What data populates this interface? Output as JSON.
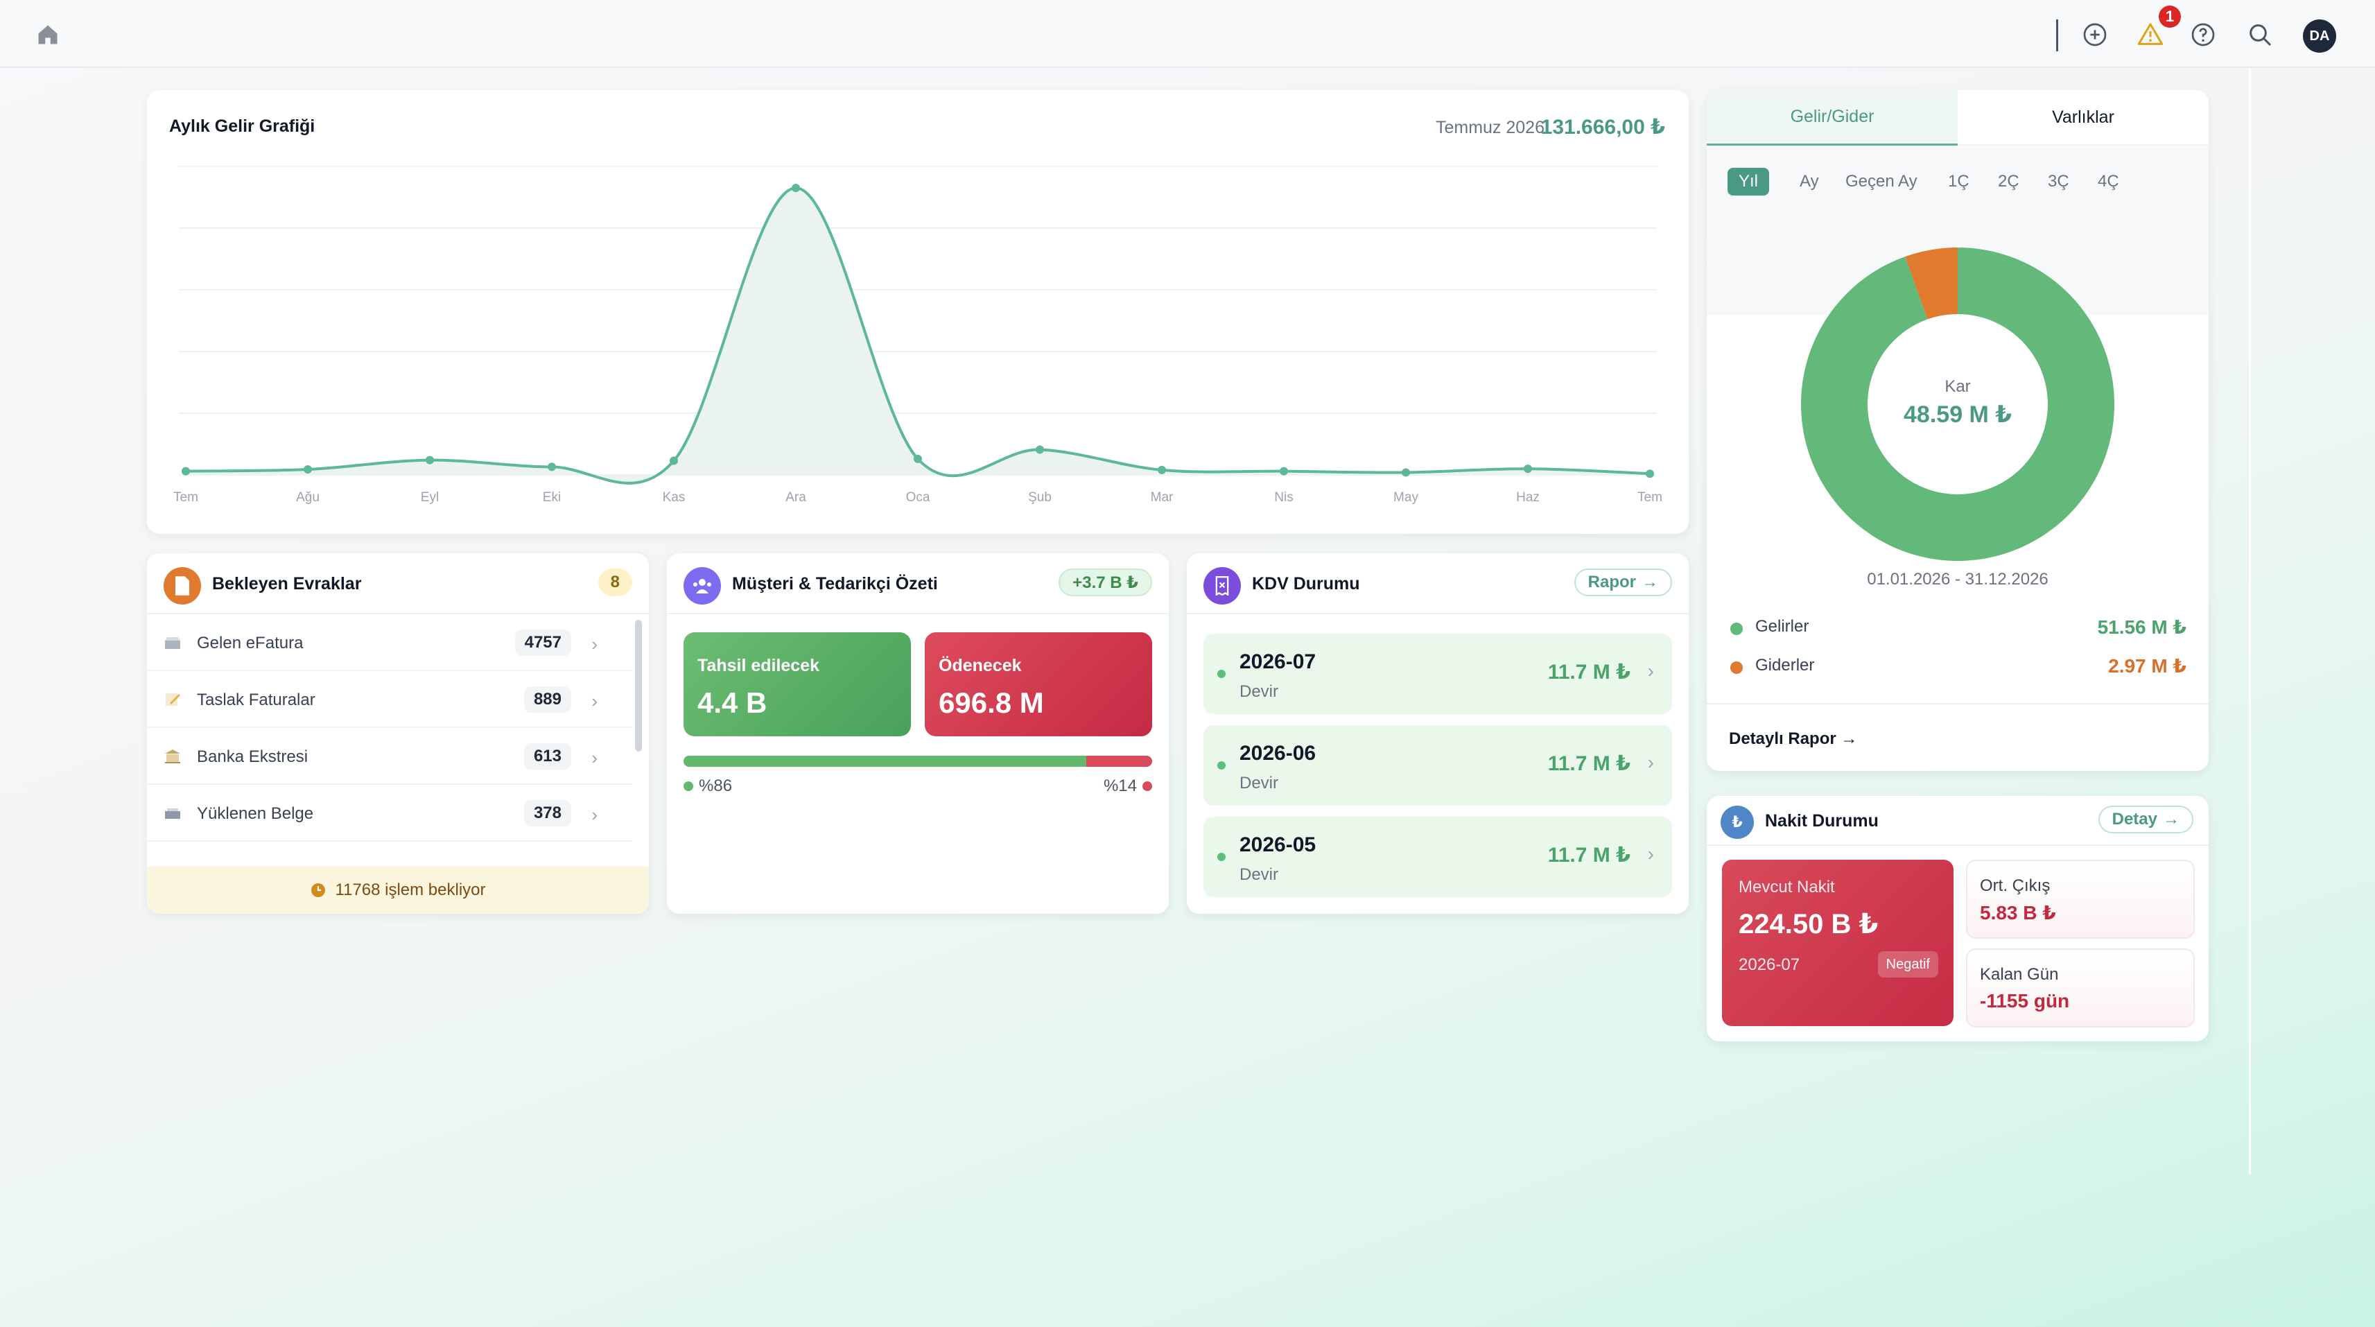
{
  "header": {
    "alert_count": "1",
    "user_initials": "DA"
  },
  "revenue_chart": {
    "title": "Aylık Gelir Grafiği",
    "period": "Temmuz 2026",
    "total": "131.666,00 ₺"
  },
  "chart_data": {
    "type": "area",
    "categories": [
      "Tem",
      "Ağu",
      "Eyl",
      "Eki",
      "Kas",
      "Ara",
      "Oca",
      "Şub",
      "Mar",
      "Nis",
      "May",
      "Haz",
      "Tem"
    ],
    "series": [
      {
        "values": [
          0.6,
          0.9,
          2.4,
          1.3,
          2.3,
          46.5,
          2.6,
          4.1,
          0.8,
          0.6,
          0.4,
          1.0,
          0.2
        ]
      }
    ],
    "ylim": [
      0,
      50
    ],
    "grid": true,
    "colors": {
      "line": "#5db79a",
      "fill": "#eaf3ef"
    }
  },
  "pending_docs": {
    "title": "Bekleyen Evraklar",
    "badge": "8",
    "items": [
      {
        "label": "Gelen eFatura",
        "count": "4757"
      },
      {
        "label": "Taslak Faturalar",
        "count": "889"
      },
      {
        "label": "Banka Ekstresi",
        "count": "613"
      },
      {
        "label": "Yüklenen Belge",
        "count": "378"
      }
    ],
    "footer": "11768 işlem bekliyor"
  },
  "customer_summary": {
    "title": "Müşteri & Tedarikçi Özeti",
    "net_badge": "+3.7 B ₺",
    "receivable_label": "Tahsil edilecek",
    "receivable_value": "4.4 B",
    "payable_label": "Ödenecek",
    "payable_value": "696.8 M",
    "receivable_pct": "%86",
    "payable_pct": "%14",
    "receivable_share": 0.86,
    "colors": {
      "receivable": "#62b96e",
      "payable": "#d94a5a"
    }
  },
  "kdv": {
    "title": "KDV Durumu",
    "report_label": "Rapor",
    "rows": [
      {
        "period": "2026-07",
        "status": "Devir",
        "amount": "11.7 M ₺"
      },
      {
        "period": "2026-06",
        "status": "Devir",
        "amount": "11.7 M ₺"
      },
      {
        "period": "2026-05",
        "status": "Devir",
        "amount": "11.7 M ₺"
      }
    ]
  },
  "income_expense": {
    "tabs": [
      "Gelir/Gider",
      "Varlıklar"
    ],
    "active_tab": "Gelir/Gider",
    "ranges": [
      "Yıl",
      "Ay",
      "Geçen Ay",
      "1Ç",
      "2Ç",
      "3Ç",
      "4Ç"
    ],
    "active_range": "Yıl",
    "center_label": "Kar",
    "center_value": "48.59 M ₺",
    "date_range": "01.01.2026 - 31.12.2026",
    "legend": [
      {
        "name": "Gelirler",
        "value": "51.56 M ₺",
        "amount": 51.56,
        "color": "#62b97a"
      },
      {
        "name": "Giderler",
        "value": "2.97 M ₺",
        "amount": 2.97,
        "color": "#e07a2e"
      }
    ],
    "detail_link": "Detaylı Rapor"
  },
  "cash": {
    "title": "Nakit Durumu",
    "detail_label": "Detay",
    "current_label": "Mevcut Nakit",
    "current_value": "224.50 B ₺",
    "period": "2026-07",
    "status_badge": "Negatif",
    "avg_out_label": "Ort. Çıkış",
    "avg_out_value": "5.83 B ₺",
    "days_left_label": "Kalan Gün",
    "days_left_value": "-1155 gün"
  }
}
